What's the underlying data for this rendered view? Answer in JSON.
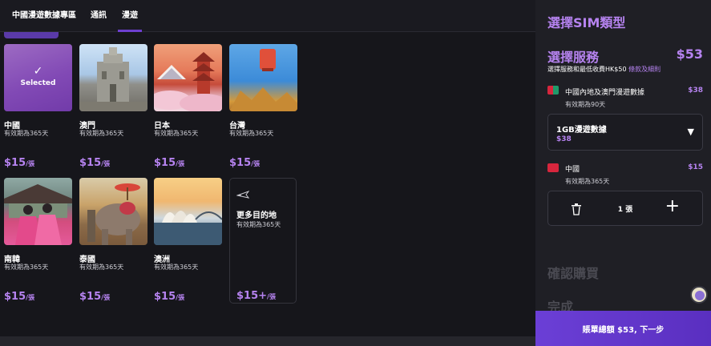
{
  "nav": {
    "tabs": [
      "中國漫遊數據專區",
      "通訊",
      "漫遊"
    ],
    "active_tab": "漫遊"
  },
  "destinations": [
    {
      "name": "中國",
      "validity": "有效期為365天",
      "price": "$15",
      "unit": "/張",
      "selected": true,
      "selected_label": "Selected",
      "check": "✓"
    },
    {
      "name": "澳門",
      "validity": "有效期為365天",
      "price": "$15",
      "unit": "/張",
      "selected": false
    },
    {
      "name": "日本",
      "validity": "有效期為365天",
      "price": "$15",
      "unit": "/張",
      "selected": false
    },
    {
      "name": "台灣",
      "validity": "有效期為365天",
      "price": "$15",
      "unit": "/張",
      "selected": false
    },
    {
      "name": "南韓",
      "validity": "有效期為365天",
      "price": "$15",
      "unit": "/張",
      "selected": false
    },
    {
      "name": "泰國",
      "validity": "有效期為365天",
      "price": "$15",
      "unit": "/張",
      "selected": false
    },
    {
      "name": "澳洲",
      "validity": "有效期為365天",
      "price": "$15",
      "unit": "/張",
      "selected": false
    }
  ],
  "more_destinations": {
    "title": "更多目的地",
    "validity": "有效期為365天",
    "price": "$15+",
    "unit": "/張",
    "icon": "airplane-icon"
  },
  "panel": {
    "title": "選擇SIM類型",
    "service_heading": "選擇服務",
    "total": "$53",
    "note_text": "選擇服務和最低收費HK$50",
    "note_link": "條款及細則",
    "item1": {
      "title": "中國內地及澳門漫遊數據",
      "validity": "有效期為90天",
      "price": "$38",
      "icon": "china-macau-flag-icon"
    },
    "plan": {
      "name": "1GB漫遊數據",
      "price": "$38",
      "caret": "▼"
    },
    "item2": {
      "title": "中國",
      "validity": "有效期為365天",
      "price": "$15",
      "icon": "china-flag-icon"
    },
    "quantity": "1 張",
    "plus": "+",
    "step_confirm": "確認購買",
    "step_done": "完成"
  },
  "cta": {
    "label": "賬單總額 $53, 下一步"
  },
  "colors": {
    "accent": "#b683f0",
    "cta": "#6b3fd6",
    "background": "#16161b",
    "panel": "#1f1f25"
  }
}
